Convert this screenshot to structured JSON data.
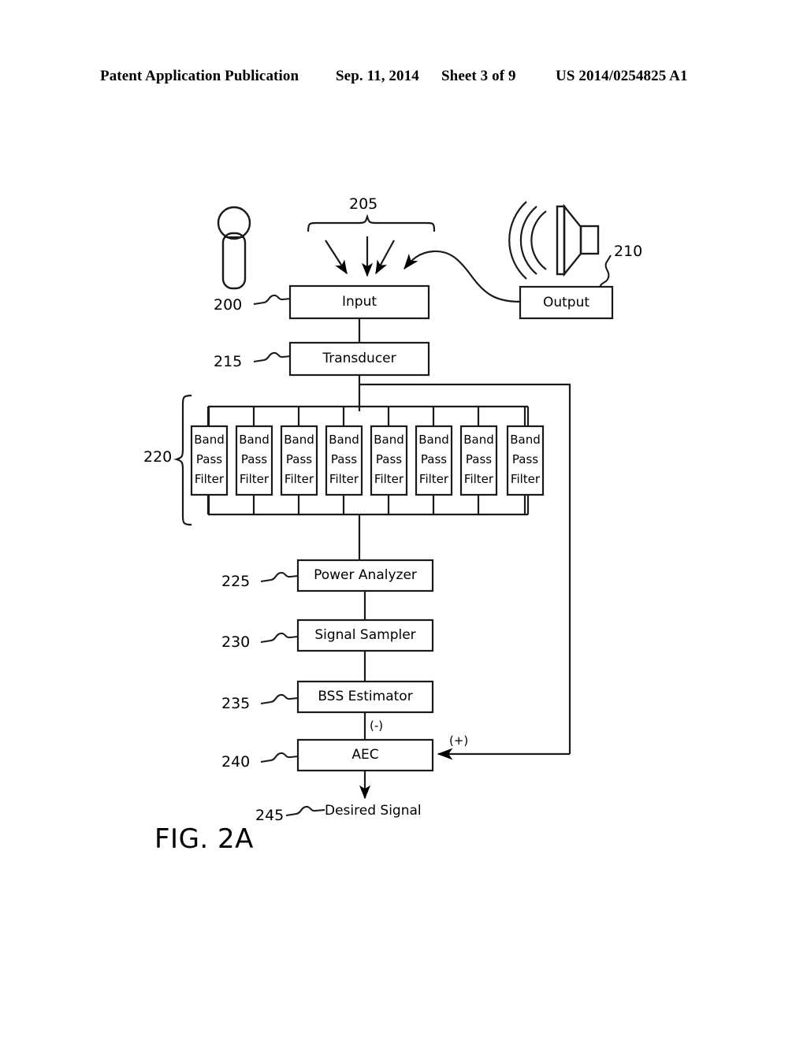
{
  "header": {
    "publication": "Patent Application Publication",
    "date": "Sep. 11, 2014",
    "sheet": "Sheet 3 of 9",
    "patent_number": "US 2014/0254825 A1"
  },
  "figure": {
    "title": "FIG. 2A",
    "icons": {
      "microphone": "microphone-icon",
      "loudspeaker": "loudspeaker-icon"
    },
    "blocks": [
      {
        "id": "input",
        "label": "Input",
        "ref": "200"
      },
      {
        "id": "output",
        "label": "Output",
        "ref": "210"
      },
      {
        "id": "transducer",
        "label": "Transducer",
        "ref": "215"
      },
      {
        "id": "power_analyzer",
        "label": "Power Analyzer",
        "ref": "225"
      },
      {
        "id": "signal_sampler",
        "label": "Signal Sampler",
        "ref": "230"
      },
      {
        "id": "bss_estimator",
        "label": "BSS Estimator",
        "ref": "235"
      },
      {
        "id": "aec",
        "label": "AEC",
        "ref": "240"
      }
    ],
    "filter_bank": {
      "ref": "220",
      "filter_label_lines": [
        "Band",
        "Pass",
        "Filter"
      ],
      "count": 8
    },
    "acoustic_input": {
      "ref": "205"
    },
    "output_signal": {
      "ref": "245",
      "label": "Desired Signal"
    },
    "signs": {
      "negative": "(-)",
      "positive": "(+)"
    }
  }
}
